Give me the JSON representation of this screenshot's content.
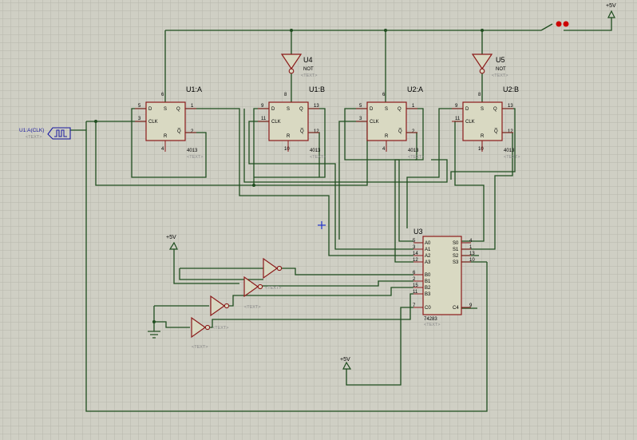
{
  "colors": {
    "background": "#cfcfc4",
    "grid": "#b7b7ac",
    "wire": "#1f4d1f",
    "chip_fill": "#d9d9c2",
    "chip_stroke": "#8b1a1a",
    "pin_text": "#000000",
    "label_text": "#000000",
    "placeholder_text": "#8a8a8a",
    "generator": "#1a1aa0",
    "switch_dot": "#cc0000"
  },
  "flipflops": [
    {
      "name": "U1:A",
      "part": "4013",
      "pins": {
        "d": "5",
        "s": "6",
        "clk": "3",
        "r": "4",
        "q": "1",
        "qn": "2"
      }
    },
    {
      "name": "U1:B",
      "part": "4013",
      "pins": {
        "d": "9",
        "s": "8",
        "clk": "11",
        "r": "10",
        "q": "13",
        "qn": "12"
      }
    },
    {
      "name": "U2:A",
      "part": "4013",
      "pins": {
        "d": "5",
        "s": "6",
        "clk": "3",
        "r": "4",
        "q": "1",
        "qn": "2"
      }
    },
    {
      "name": "U2:B",
      "part": "4013",
      "pins": {
        "d": "9",
        "s": "8",
        "clk": "11",
        "r": "10",
        "q": "13",
        "qn": "12"
      }
    }
  ],
  "pin_labels": {
    "d": "D",
    "s": "S",
    "clk": "CLK",
    "r": "R",
    "q": "Q",
    "qn": "Q̅"
  },
  "adder": {
    "name": "U3",
    "part": "74283",
    "inputs": [
      {
        "pin": "5",
        "label": "A0"
      },
      {
        "pin": "3",
        "label": "A1"
      },
      {
        "pin": "14",
        "label": "A2"
      },
      {
        "pin": "12",
        "label": "A3"
      },
      {
        "pin": "6",
        "label": "B0"
      },
      {
        "pin": "2",
        "label": "B1"
      },
      {
        "pin": "15",
        "label": "B2"
      },
      {
        "pin": "11",
        "label": "B3"
      },
      {
        "pin": "7",
        "label": "C0"
      }
    ],
    "outputs": [
      {
        "pin": "4",
        "label": "S0"
      },
      {
        "pin": "1",
        "label": "S1"
      },
      {
        "pin": "13",
        "label": "S2"
      },
      {
        "pin": "10",
        "label": "S3"
      },
      {
        "pin": "9",
        "label": "C4"
      }
    ]
  },
  "top_inverters": [
    {
      "name": "U4",
      "part": "NOT",
      "placeholder": "<TEXT>"
    },
    {
      "name": "U5",
      "part": "NOT",
      "placeholder": "<TEXT>"
    }
  ],
  "left_inverters": [
    "<TEXT>",
    "<TEXT>",
    "<TEXT>",
    "<TEXT>"
  ],
  "text_placeholder": "<TEXT>",
  "power": [
    "+5V",
    "+5V",
    "+5V"
  ],
  "generator": {
    "label": "U1:A(CLK)",
    "placeholder": "<TEXT>"
  }
}
